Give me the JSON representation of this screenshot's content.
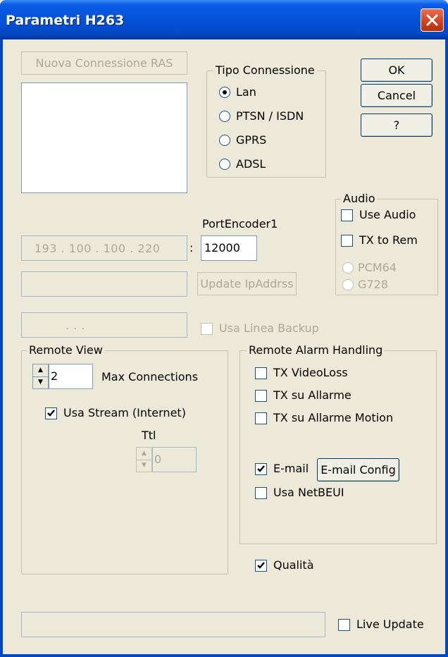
{
  "window": {
    "title": "Parametri H263",
    "close_icon": "close-icon"
  },
  "buttons": {
    "new_ras": "Nuova Connessione RAS",
    "ok": "OK",
    "cancel": "Cancel",
    "help": "?",
    "update_ip": "Update IpAddrss",
    "email_config": "E-mail Config"
  },
  "connection_type": {
    "legend": "Tipo Connessione",
    "selected": "Lan",
    "options": [
      "Lan",
      "PTSN / ISDN",
      "GPRS",
      "ADSL"
    ]
  },
  "audio": {
    "legend": "Audio",
    "use_audio": {
      "label": "Use Audio",
      "checked": false
    },
    "tx_to_rem": {
      "label": "TX to Rem",
      "checked": false
    },
    "codecs": [
      "PCM64",
      "G728"
    ]
  },
  "network": {
    "port_label": "PortEncoder1",
    "port_value": "12000",
    "ip_address": "193 . 100 . 100 . 220",
    "ip_separator": ":",
    "backup_ip": ".        .        .",
    "backup_line_label": "Usa Linea Backup"
  },
  "remote_view": {
    "legend": "Remote View",
    "max_connections_value": "2",
    "max_connections_label": "Max Connections",
    "use_stream_label": "Usa Stream (Internet)",
    "use_stream_checked": true,
    "ttl_label": "Ttl",
    "ttl_value": "0"
  },
  "alarm": {
    "legend": "Remote Alarm Handling",
    "tx_videoloss": "TX VideoLoss",
    "tx_su_allarme": "TX su Allarme",
    "tx_su_allarme_motion": "TX su Allarme Motion",
    "email_label": "E-mail",
    "email_checked": true,
    "netbeui_label": "Usa NetBEUI"
  },
  "quality": {
    "label": "Qualità",
    "checked": true
  },
  "live_update": {
    "label": "Live Update",
    "checked": false
  }
}
